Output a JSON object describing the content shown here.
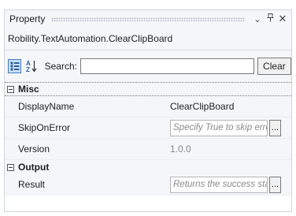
{
  "window": {
    "title": "Property",
    "buttons": {
      "dropdown": "⌄",
      "pin": "🖈",
      "close": "✕"
    }
  },
  "subtitle": "Robility.TextAutomation.ClearClipBoard",
  "toolbar": {
    "search_label": "Search:",
    "search_value": "",
    "clear_label": "Clear",
    "icons": [
      "categorized-view-icon",
      "sort-alphabetical-icon"
    ]
  },
  "categories": [
    {
      "name": "Misc",
      "properties": [
        {
          "name": "DisplayName",
          "value": "ClearClipBoard",
          "type": "text"
        },
        {
          "name": "SkipOnError",
          "placeholder": "Specify True to skip errors d",
          "type": "input"
        },
        {
          "name": "Version",
          "value": "1.0.0",
          "type": "readonly"
        }
      ]
    },
    {
      "name": "Output",
      "properties": [
        {
          "name": "Result",
          "placeholder": "Returns the success state of",
          "type": "input"
        }
      ]
    }
  ],
  "ellipsis_label": "...",
  "colors": {
    "accent": "#3f7cc7",
    "panel_bg": "#f5f6f8"
  }
}
